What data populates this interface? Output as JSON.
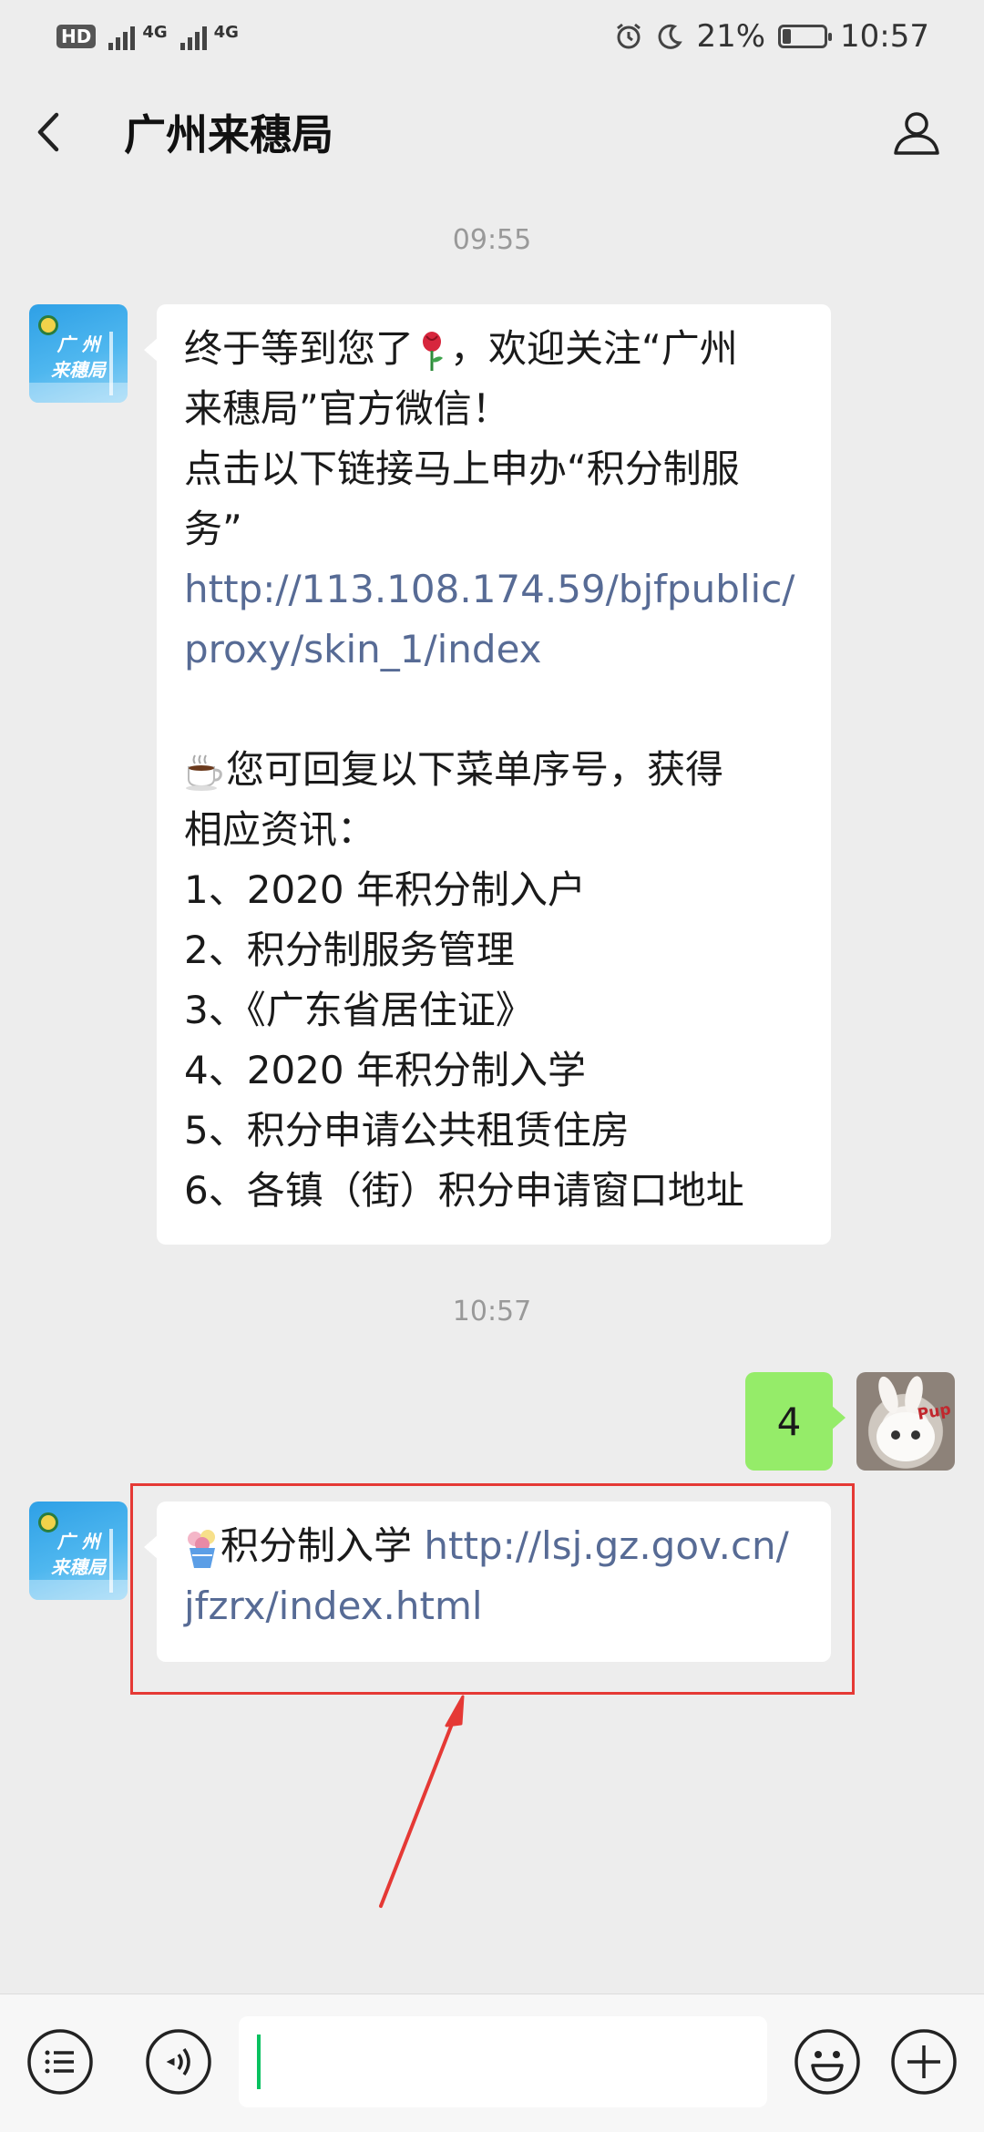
{
  "status_bar": {
    "hd_label": "HD",
    "network_1": "4G",
    "network_2": "4G",
    "battery_percent": "21%",
    "battery_level": 0.21,
    "time": "10:57"
  },
  "header": {
    "title": "广州来穗局"
  },
  "chat": {
    "timestamp_1": "09:55",
    "timestamp_2": "10:57",
    "contact_avatar_text": "广州来穗局",
    "welcome_message": {
      "line1": "终于等到您了",
      "line1_end": "，欢迎关注“广州",
      "line2": "来穗局”官方微信！",
      "line3": "点击以下链接马上申办“积分制服",
      "line4": "务”",
      "link_line1": "http://113.108.174.59/bjfpublic/",
      "link_line2": "proxy/skin_1/index",
      "menu_intro_1": "您可回复以下菜单序号，获得",
      "menu_intro_2": "相应资讯：",
      "menu_items": [
        "1、2020 年积分制入户",
        "2、积分制服务管理",
        "3、《广东省居住证》",
        "4、2020 年积分制入学",
        "5、积分申请公共租赁住房",
        "6、各镇（街）积分申请窗口地址"
      ]
    },
    "sent_message": "4",
    "user_avatar_tag": "Pup",
    "reply_message": {
      "text": "积分制入学",
      "link_line1": "http://lsj.gz.gov.cn/",
      "link_line2": "jfzrx/index.html"
    }
  },
  "icons": {
    "back": "chevron-left-icon",
    "profile": "person-icon",
    "rose": "rose-emoji-icon",
    "coffee": "coffee-emoji-icon",
    "icecream": "icecream-emoji-icon",
    "menu": "list-menu-icon",
    "voice": "voice-icon",
    "emoji": "smiley-icon",
    "plus": "plus-icon"
  },
  "colors": {
    "link": "#576b95",
    "sent_bubble": "#95ec69",
    "annotation": "#e53935",
    "cursor": "#07c160"
  }
}
